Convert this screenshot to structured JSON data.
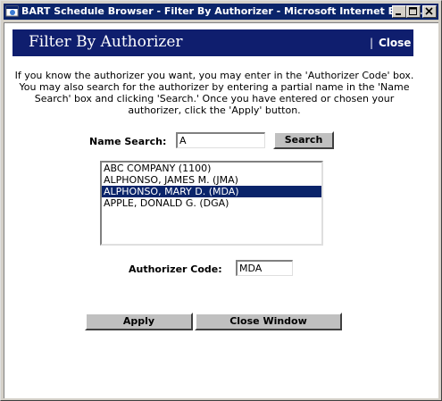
{
  "window": {
    "title": "BART Schedule Browser - Filter By Authorizer - Microsoft Internet Expl..."
  },
  "header": {
    "title": "Filter By Authorizer",
    "separator": "|",
    "close_label": "Close"
  },
  "instructions": "If you know the authorizer you want, you may enter in the 'Authorizer Code' box. You may also search for the authorizer by entering a partial name in the 'Name Search' box and clicking 'Search.' Once you have entered or chosen your authorizer, click the 'Apply' button.",
  "search": {
    "label": "Name Search:",
    "value": "A",
    "button_label": "Search"
  },
  "authorizers": [
    {
      "label": "ABC COMPANY (1100)",
      "selected": false
    },
    {
      "label": "ALPHONSO, JAMES M. (JMA)",
      "selected": false
    },
    {
      "label": "ALPHONSO, MARY D. (MDA)",
      "selected": true
    },
    {
      "label": "APPLE, DONALD G. (DGA)",
      "selected": false
    }
  ],
  "authorizer_code": {
    "label": "Authorizer Code:",
    "value": "MDA"
  },
  "actions": {
    "apply_label": "Apply",
    "close_window_label": "Close Window"
  },
  "colors": {
    "titlebar": "#0a246a",
    "header_bar": "#0f1e6e",
    "selection": "#0a246a",
    "button_face": "#c0c0c0"
  }
}
